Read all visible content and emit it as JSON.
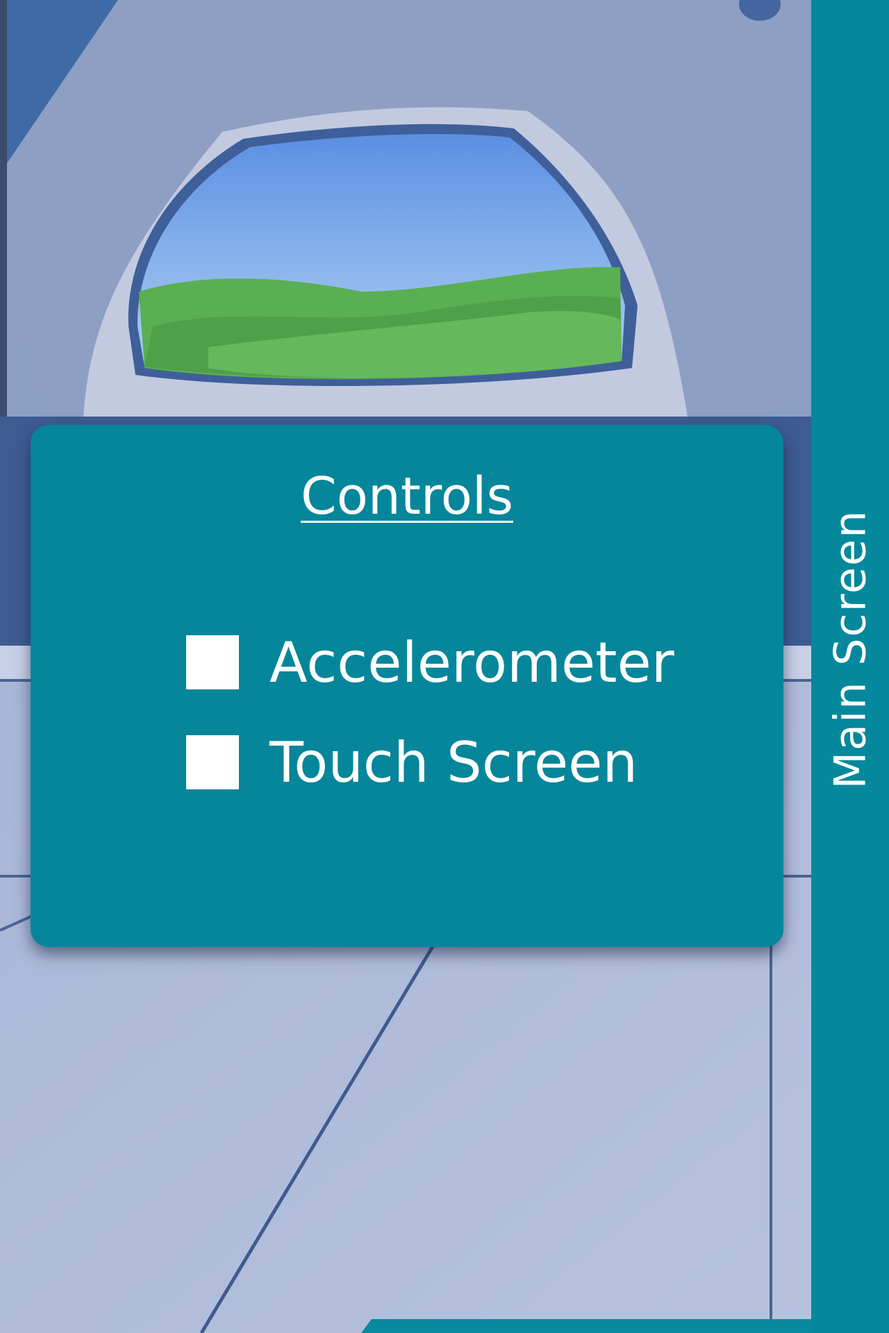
{
  "sidebar": {
    "label": "Main Screen"
  },
  "controls_dialog": {
    "title": "Controls",
    "options": [
      {
        "label": "Accelerometer",
        "checked": false
      },
      {
        "label": "Touch Screen",
        "checked": false
      }
    ]
  },
  "colors": {
    "accent": "#05889c",
    "panel": "#05869a",
    "text": "#ffffff",
    "backdrop": "#aeb9d6"
  }
}
